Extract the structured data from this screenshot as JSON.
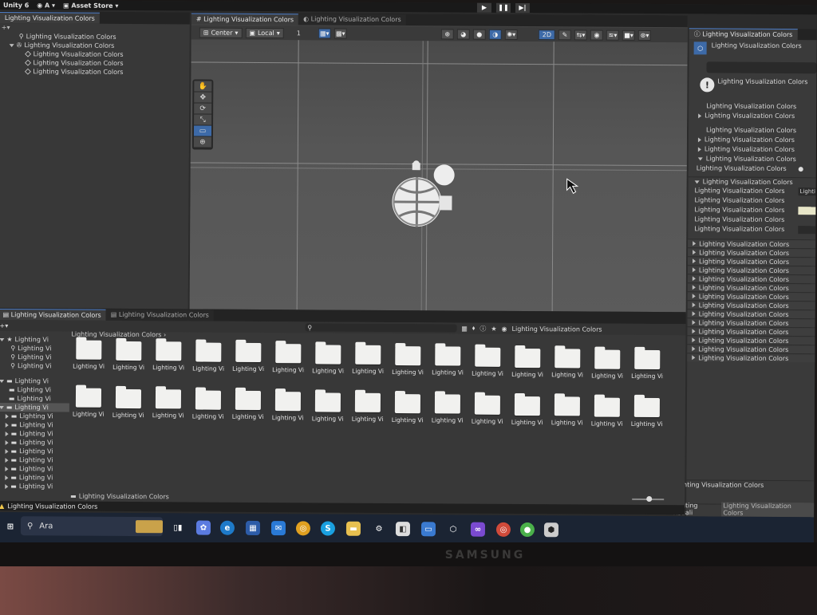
{
  "app": {
    "name": "Unity 6",
    "account": "A",
    "asset_store": "Asset Store"
  },
  "label": "Lighting Visualization Colors",
  "short_label": "Lighting Vi",
  "hierarchy": {
    "tab": "Lighting Visualization Colors",
    "root": "Lighting Visualization Colors",
    "items": [
      "Lighting Visualization Colors",
      "Lighting Visualization Colors",
      "Lighting Visualization Colors"
    ]
  },
  "scene": {
    "tab_active": "Lighting Visualization Colors",
    "tab_inactive": "Lighting Visualization Colors",
    "pivot": "Center",
    "space": "Local",
    "snap": "1",
    "mode_2d": "2D"
  },
  "project": {
    "tab_active": "Lighting Visualization Colors",
    "tab_inactive": "Lighting Visualization Colors",
    "breadcrumb": "Lighting Visualization Colors",
    "filter_label": "Lighting Visualization Colors",
    "selected_path": "Lighting Visualization Colors",
    "folder_label": "Lighting Vis"
  },
  "inspector": {
    "tab": "Lighting Visualization Colors",
    "title": "Lighting Visualization Colors",
    "warning": "Lighting Visualization Colors",
    "field_value": "Lighti",
    "footer_label": "Lighting Visualization Colors",
    "footer_left": "Lighting Visuali",
    "footer_right": "Lighting Visualization Colors"
  },
  "status": {
    "text": "Lighting Visualization Colors"
  },
  "taskbar": {
    "search": "Ara"
  },
  "monitor": {
    "brand": "SAMSUNG"
  },
  "colors": {
    "accent": "#3d6aa8",
    "panel": "#383838",
    "viewport": "#555555",
    "taskbar": "#1b2433"
  }
}
